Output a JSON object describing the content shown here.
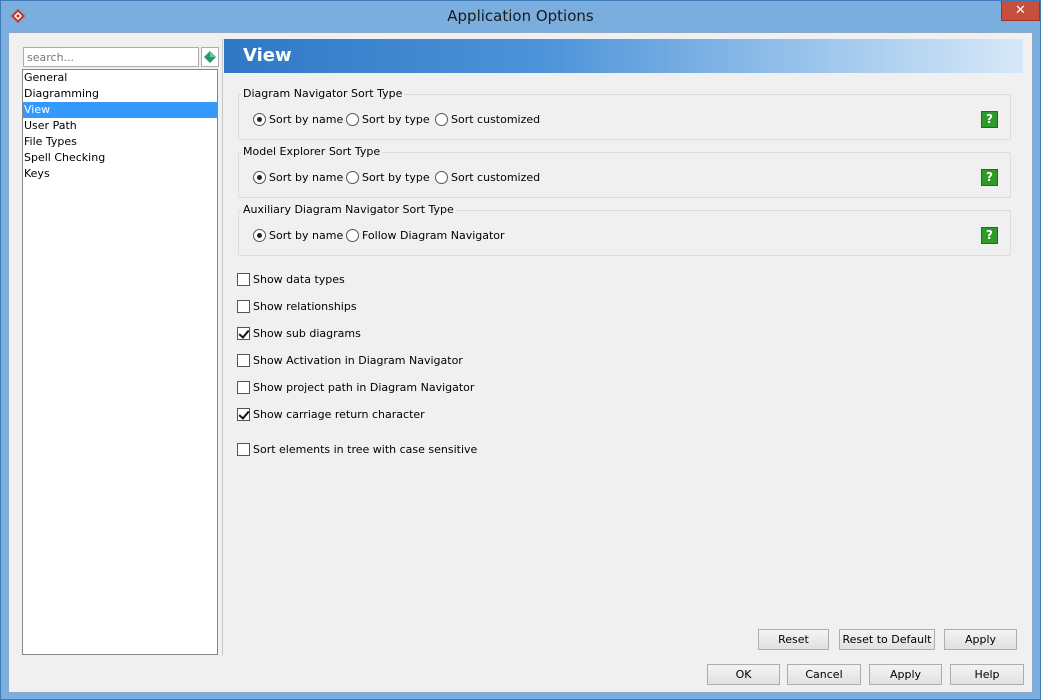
{
  "window": {
    "title": "Application Options",
    "close_glyph": "✕"
  },
  "search": {
    "placeholder": "search..."
  },
  "nav": {
    "items": [
      {
        "label": "General"
      },
      {
        "label": "Diagramming"
      },
      {
        "label": "View"
      },
      {
        "label": "User Path"
      },
      {
        "label": "File Types"
      },
      {
        "label": "Spell Checking"
      },
      {
        "label": "Keys"
      }
    ],
    "selected": "View"
  },
  "panel": {
    "title": "View",
    "groups": [
      {
        "title": "Diagram Navigator Sort Type",
        "options": [
          "Sort by name",
          "Sort by type",
          "Sort customized"
        ],
        "selected": "Sort by name"
      },
      {
        "title": "Model Explorer Sort Type",
        "options": [
          "Sort by name",
          "Sort by type",
          "Sort customized"
        ],
        "selected": "Sort by name"
      },
      {
        "title": "Auxiliary Diagram Navigator Sort Type",
        "options": [
          "Sort by name",
          "Follow Diagram Navigator"
        ],
        "selected": "Sort by name"
      }
    ],
    "help_glyph": "?",
    "checkboxes": [
      {
        "label": "Show data types",
        "checked": false
      },
      {
        "label": "Show relationships",
        "checked": false
      },
      {
        "label": "Show sub diagrams",
        "checked": true
      },
      {
        "label": "Show Activation in Diagram Navigator",
        "checked": false
      },
      {
        "label": "Show project path in Diagram Navigator",
        "checked": false
      },
      {
        "label": "Show carriage return character",
        "checked": true
      },
      {
        "label": "Sort elements in tree with case sensitive",
        "checked": false
      }
    ],
    "buttons": {
      "reset": "Reset",
      "reset_default": "Reset to Default",
      "apply": "Apply"
    }
  },
  "footer": {
    "ok": "OK",
    "cancel": "Cancel",
    "apply": "Apply",
    "help": "Help"
  },
  "colors": {
    "accent": "#3399ff",
    "help_green": "#2d9a2a",
    "header_blue": "#2f78c4"
  }
}
